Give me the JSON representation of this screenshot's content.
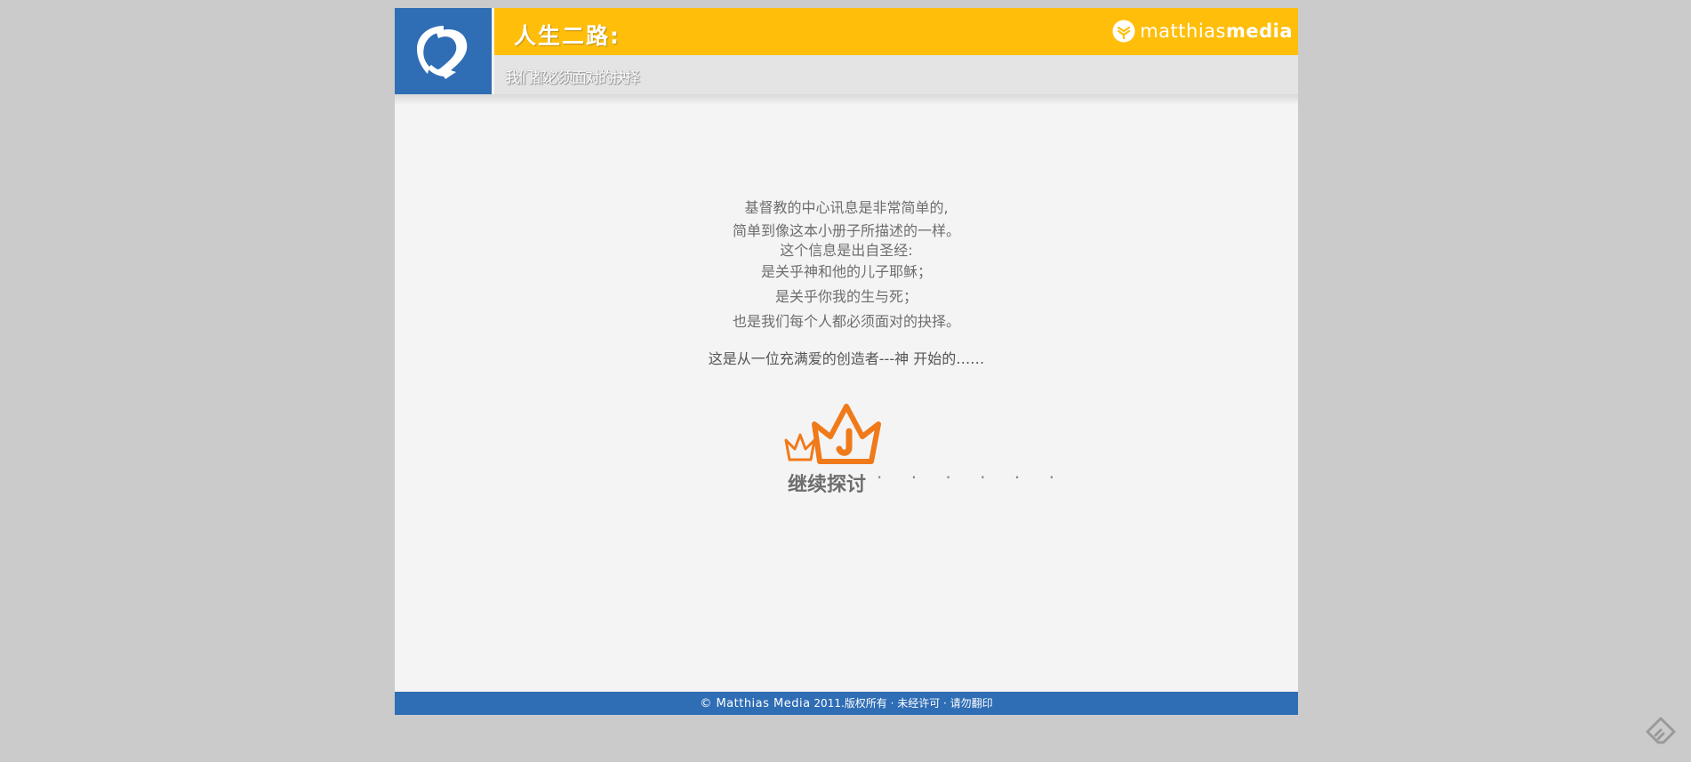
{
  "header": {
    "logo_icon": "two-ways-icon",
    "title": "人生二路:",
    "subtitle": "我们都必须面对的抉择",
    "brand_prefix": "matthias",
    "brand_suffix": "media",
    "brand_icon": "matthias-media-leaf-icon"
  },
  "main": {
    "lines": [
      "基督教的中心讯息是非常简单的,",
      "简单到像这本小册子所描述的一样。",
      "这个信息是出自圣经:",
      "是关乎神和他的儿子耶稣；",
      "是关乎你我的生与死；",
      "也是我们每个人都必须面对的抉择。"
    ],
    "lead": "这是从一位充满爱的创造者---神 开始的……",
    "continue_label": "继续探讨",
    "continue_dots": "· · · · · ·",
    "continue_icon": "crown-j-icon"
  },
  "footer": {
    "copyright": "© Matthias Media",
    "rights": "2011.版权所有 · 未经许可 · 请勿翻印"
  },
  "colors": {
    "blue": "#2f6db5",
    "yellow": "#ffbe0a",
    "orange": "#f07a1a",
    "page_bg": "#f4f4f4",
    "outer_bg": "#cbcbcb"
  }
}
